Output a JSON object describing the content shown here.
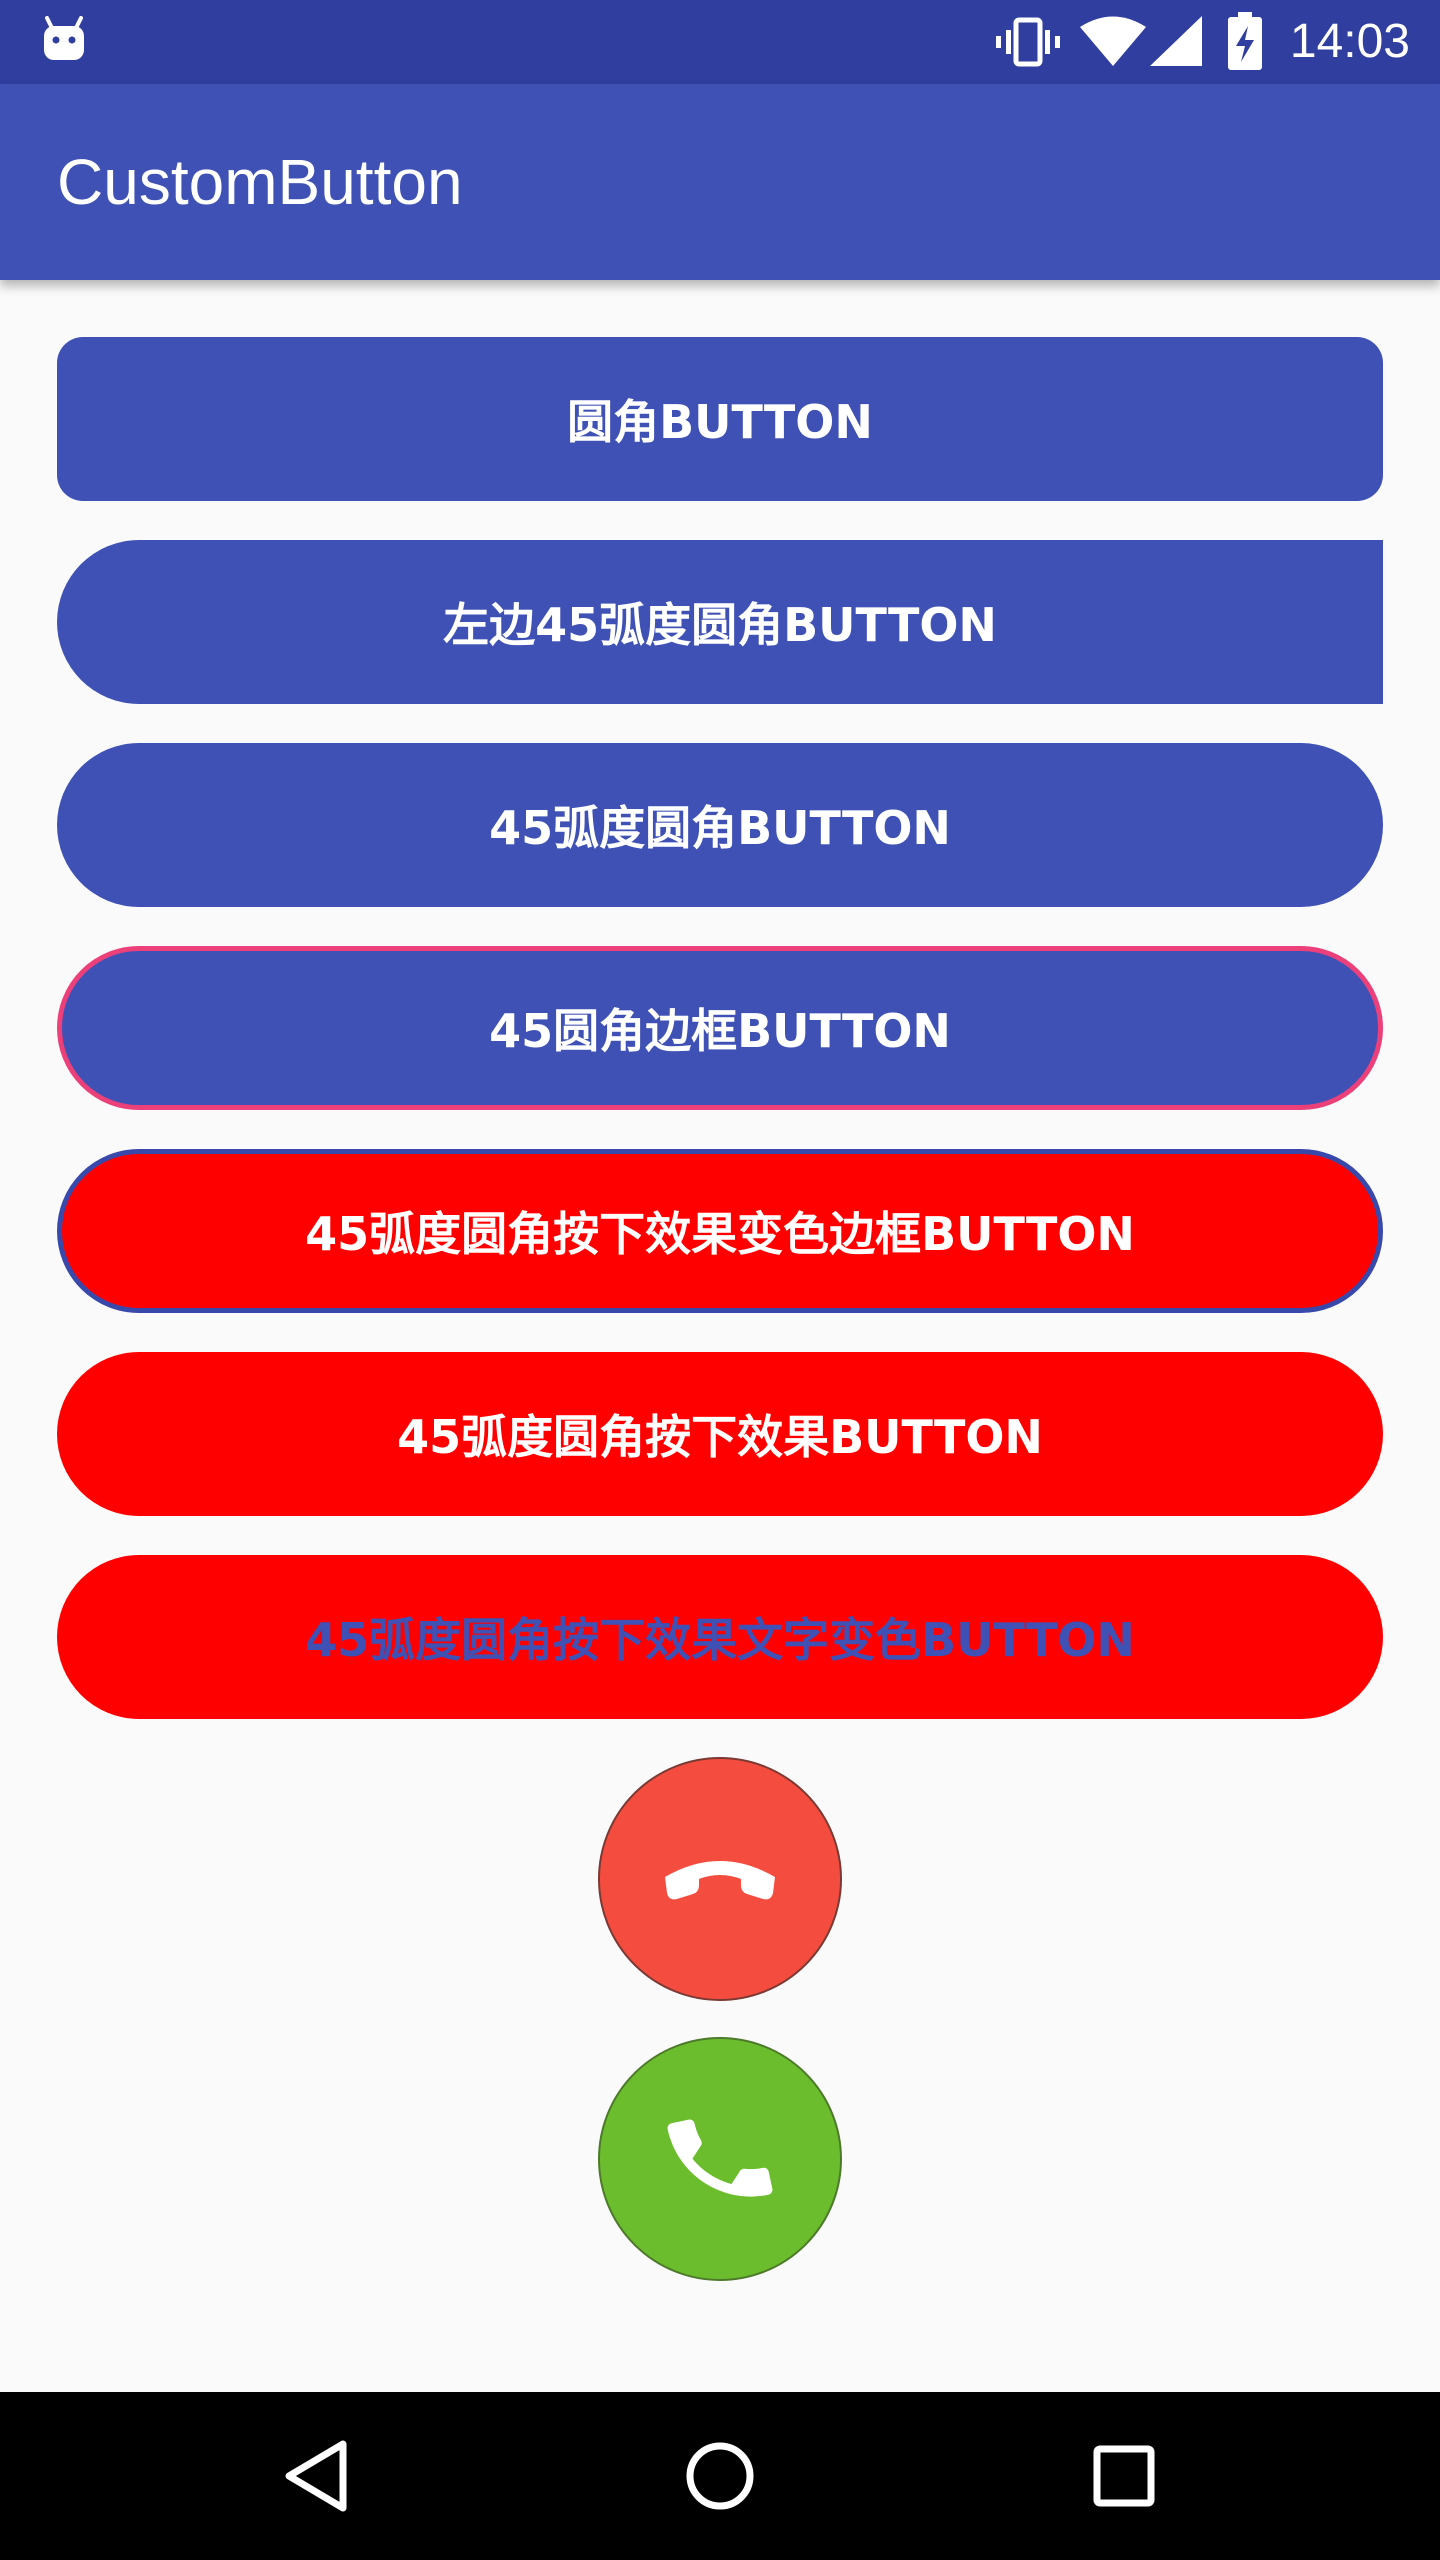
{
  "status_bar": {
    "time": "14:03",
    "icons": [
      "android-notification-icon",
      "vibrate-icon",
      "wifi-icon",
      "cell-signal-icon",
      "battery-charging-icon"
    ]
  },
  "app_bar": {
    "title": "CustomButton"
  },
  "buttons": [
    {
      "label": "圆角BUTTON"
    },
    {
      "label": "左边45弧度圆角BUTTON"
    },
    {
      "label": "45弧度圆角BUTTON"
    },
    {
      "label": "45圆角边框BUTTON"
    },
    {
      "label": "45弧度圆角按下效果变色边框BUTTON"
    },
    {
      "label": "45弧度圆角按下效果BUTTON"
    },
    {
      "label": "45弧度圆角按下效果文字变色BUTTON"
    }
  ],
  "call_buttons": {
    "hangup_icon": "phone-hangup-icon",
    "answer_icon": "phone-answer-icon"
  },
  "nav_bar": {
    "icons": [
      "back-icon",
      "home-icon",
      "recents-icon"
    ]
  },
  "colors": {
    "status_bar": "#303f9f",
    "primary": "#3f51b5",
    "accent_border": "#ec407a",
    "red": "#ff0000",
    "hangup": "#f44c3f",
    "answer": "#6bbd2d",
    "background": "#fafafa"
  }
}
